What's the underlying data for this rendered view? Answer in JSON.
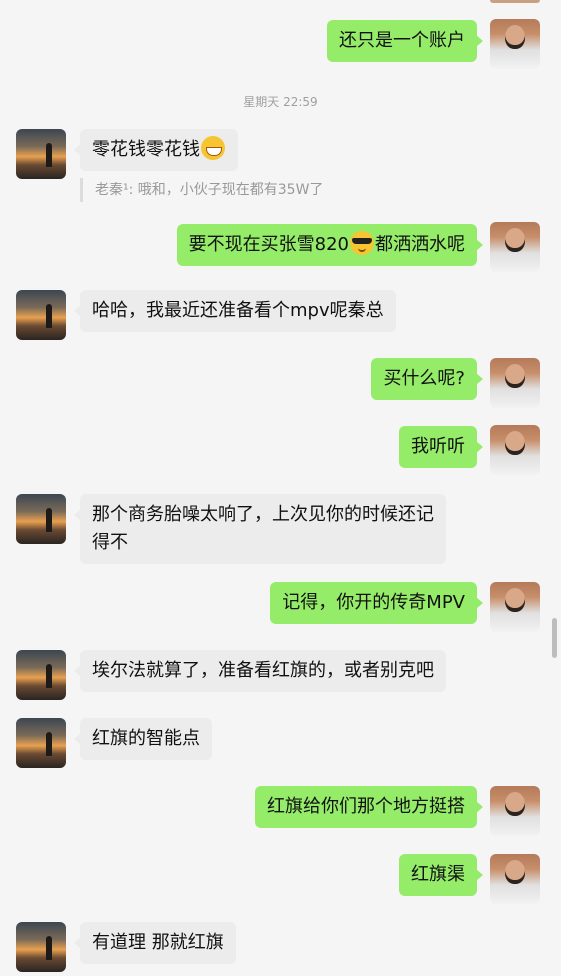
{
  "timestamp": "星期天 22:59",
  "quote": "老秦¹: 哦和，小伙子现在都有35W了",
  "messages": [
    {
      "text": "还只是一个账户"
    },
    {
      "text": "零花钱零花钱"
    },
    {
      "text_before": "要不现在买张雪820",
      "text_after": "都洒洒水呢"
    },
    {
      "text": "哈哈，我最近还准备看个mpv呢秦总"
    },
    {
      "text": "买什么呢?"
    },
    {
      "text": "我听听"
    },
    {
      "text": "那个商务胎噪太响了，上次见你的时候还记得不"
    },
    {
      "text": "记得，你开的传奇MPV"
    },
    {
      "text": "埃尔法就算了，准备看红旗的，或者别克吧"
    },
    {
      "text": "红旗的智能点"
    },
    {
      "text": "红旗给你们那个地方挺搭"
    },
    {
      "text": "红旗渠"
    },
    {
      "text": "有道理 那就红旗"
    }
  ],
  "icons": {
    "grin": "grinning-face-emoji",
    "cool": "sunglasses-face-emoji"
  }
}
